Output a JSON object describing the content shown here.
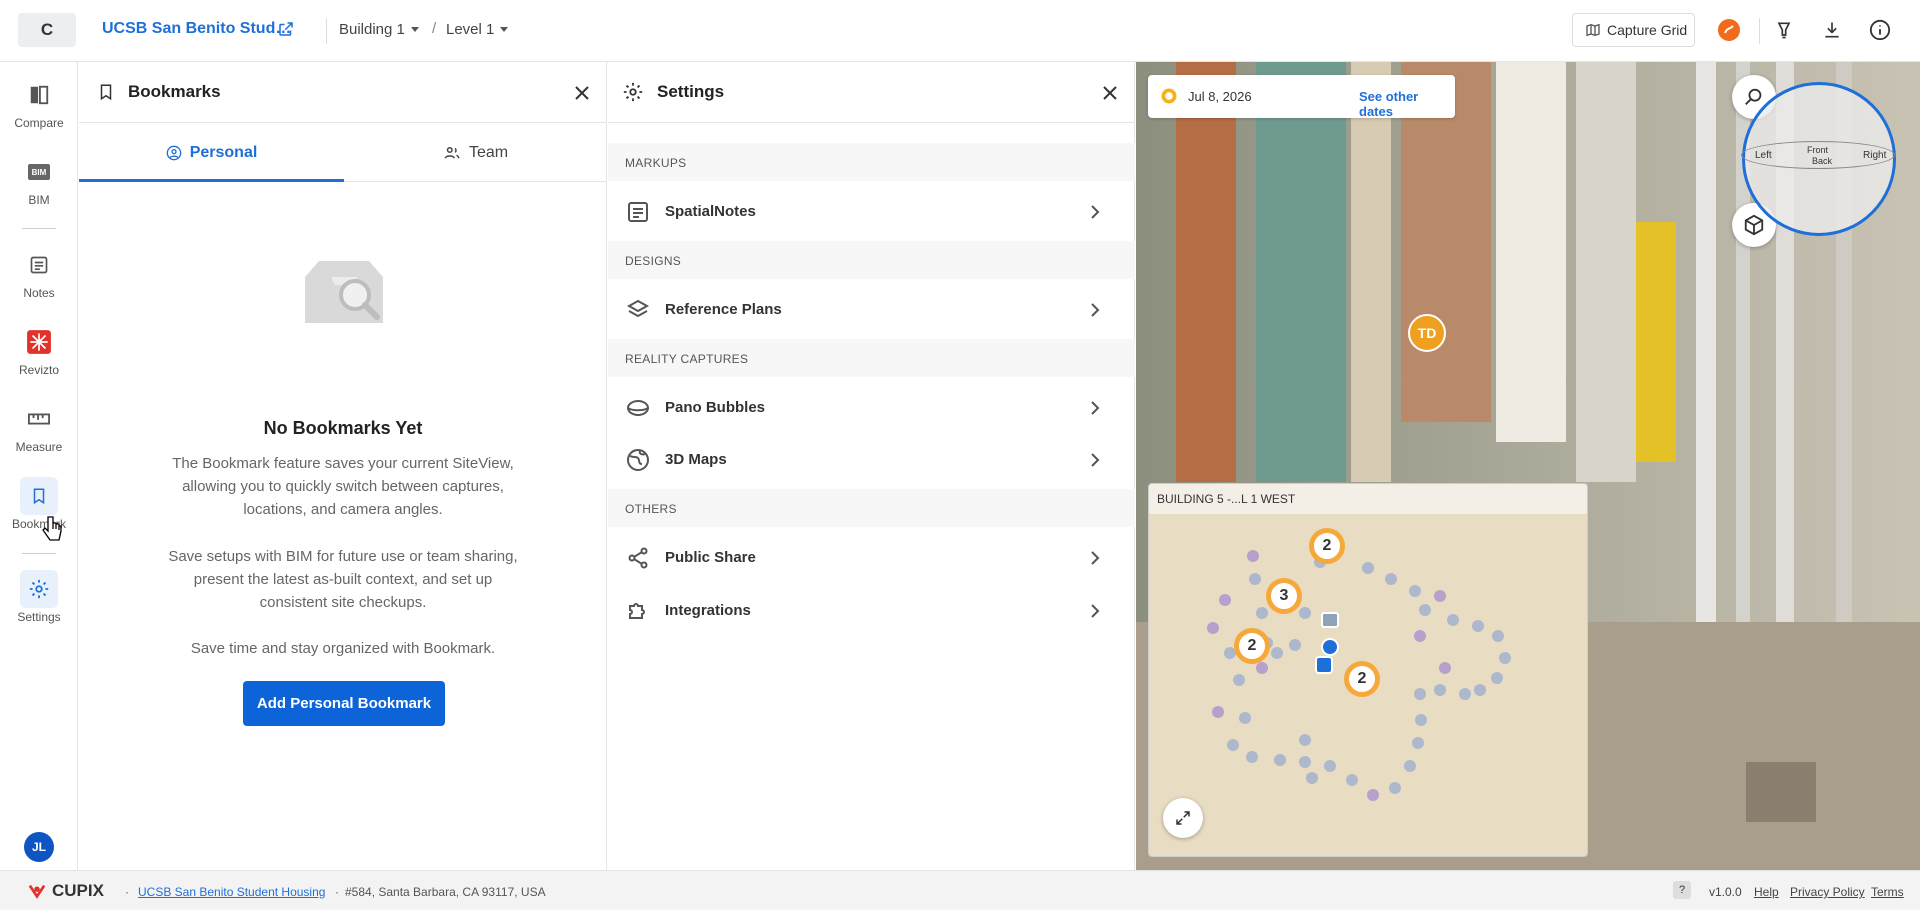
{
  "topbar": {
    "org_initial": "C",
    "project_title": "UCSB San Benito Stud…",
    "building": "Building 1",
    "separator": "/",
    "level": "Level 1",
    "capture_grid": "Capture Grid"
  },
  "rail": {
    "items": [
      {
        "label": "Compare"
      },
      {
        "label": "BIM"
      },
      {
        "label": "Notes"
      },
      {
        "label": "Revizto"
      },
      {
        "label": "Measure"
      },
      {
        "label": "Bookmark"
      },
      {
        "label": "Settings"
      }
    ],
    "bim_glyph": "BIM",
    "avatar": "JL"
  },
  "bookmarks": {
    "title": "Bookmarks",
    "tabs": [
      {
        "label": "Personal"
      },
      {
        "label": "Team"
      }
    ],
    "empty_title": "No Bookmarks Yet",
    "p1": "The Bookmark feature saves your current SiteView, allowing you to quickly switch between captures, locations, and camera angles.",
    "p2": "Save setups with BIM for future use or team sharing, present the latest as-built context, and set up consistent site checkups.",
    "p3": "Save time and stay organized with Bookmark.",
    "add_button": "Add Personal Bookmark"
  },
  "settings": {
    "title": "Settings",
    "sections": {
      "markups": "MARKUPS",
      "designs": "DESIGNS",
      "reality": "REALITY CAPTURES",
      "others": "OTHERS"
    },
    "rows": {
      "spatial_notes": "SpatialNotes",
      "reference_plans": "Reference Plans",
      "pano_bubbles": "Pano Bubbles",
      "maps_3d": "3D Maps",
      "public_share": "Public Share",
      "integrations": "Integrations"
    }
  },
  "viewer": {
    "date": "Jul 8, 2026",
    "see_other_dates": "See other dates",
    "compass": {
      "left": "Left",
      "front": "Front",
      "back": "Back",
      "right": "Right"
    },
    "pin_label": "TD",
    "minimap_title": "BUILDING 5 -...L 1 WEST",
    "clusters": [
      "2",
      "3",
      "2",
      "2"
    ]
  },
  "footer": {
    "logo": "CUPIX",
    "project_link": "UCSB San Benito Student Housing",
    "address": "#584, Santa Barbara, CA 93117, USA",
    "help_q": "?",
    "version": "v1.0.0",
    "help": "Help",
    "privacy": "Privacy Policy",
    "terms": "Terms"
  },
  "colors": {
    "accent": "#1f6fd8",
    "cluster_ring": "#f6a93a",
    "brand_red": "#e0332b"
  }
}
